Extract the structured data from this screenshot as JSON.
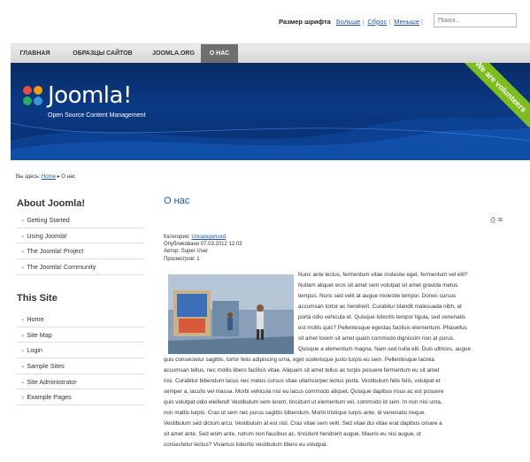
{
  "topbar": {
    "font_size_label": "Размер шрифта",
    "bigger": "Больше",
    "reset": "Сброс",
    "smaller": "Меньше",
    "search_placeholder": "Поиск..."
  },
  "nav": {
    "items": [
      {
        "label": "ГЛАВНАЯ"
      },
      {
        "label": "ОБРАЗЦЫ САЙТОВ"
      },
      {
        "label": "JOOMLA.ORG"
      },
      {
        "label": "О НАС"
      }
    ],
    "active_index": 3
  },
  "header": {
    "logo_text": "Joomla!",
    "tagline": "Open Source Content Management",
    "ribbon": "We are volunteers"
  },
  "breadcrumb": {
    "prefix": "Вы здесь:",
    "home": "Home",
    "arrow": "▸",
    "current": "О нас"
  },
  "sidebar": {
    "about": {
      "title": "About Joomla!",
      "items": [
        "Getting Started",
        "Using Joomla!",
        "The Joomla! Project",
        "The Joomla! Community"
      ]
    },
    "site": {
      "title": "This Site",
      "items": [
        "Home",
        "Site Map",
        "Login",
        "Sample Sites",
        "Site Administrator",
        "Example Pages"
      ]
    }
  },
  "article": {
    "title": "О нас",
    "category_label": "Категория:",
    "category": "Uncategorised",
    "published": "Опубликовано 07.03.2012 12:03",
    "author": "Автор: Super User",
    "hits": "Просмотров: 1",
    "right_lines": [
      "Nunc ante lectus, fermentum vitae molestie eget, fermentum vel elit?",
      "Nullam aliquet eros sit amet sem volutpat sit amet gravida metus",
      "tempus. Nunc sed velit at augue molestie tempor. Donec cursus",
      "accumsan tortor ac hendrerit. Curabitur blandit malesuada nibh, at",
      "porta odio vehicula et. Quisque lobortis tempor ligula, sed venenatis",
      "est mollis quis? Pellentesque egestas facilisis elementum. Phasellus",
      "sit amet lorem sit amet quam commodo dignissim non at purus.",
      "Quisque a elementum magna. Nam sed nulla elit. Duis ultrices, augue"
    ],
    "full_lines": [
      "quis consectetur sagittis, tortor felis adipiscing urna, eget scelerisque justo turpis eu sem. Pellentesque lacinia",
      "accumsan tellus, nec mollis libero facilisis vitae. Aliquam sit amet tellus ac turpis posuere fermentum eu sit amet",
      "nisi. Curabitur bibendum lacus nec metus cursus vitae ullamcorper lectus porta. Vestibulum felis felis, volutpat et",
      "semper a, iaculis vel massa. Morbi vehicula nisi eu lacus commodo aliquet. Quisque dapibus risus ac est posuere",
      "quis volutpat odio eleifend! Vestibulum sem lorem, tincidunt ut elementum vel, commodo id sem. In non nisi urna,",
      "non mattis turpis. Cras ut sem nec purus sagittis bibendum. Morbi tristique turpis ante, id venenatis neque.",
      "Vestibulum sed dictum arcu. Vestibulum at est nisl. Cras vitae sem velit. Sed vitae dui vitae erat dapibus ornare a",
      "sit amet ante. Sed enim ante, rutrum non faucibus ac, tincidunt hendrerit augue. Mauris eu nisi augue, ut",
      "consectetur lectus? Vivamus lobortis vestibulum libero eu volutpat."
    ]
  },
  "colors": {
    "link": "#1b57b1",
    "header_bg": "#0b3a85",
    "ribbon": "#7dbd1f",
    "nav_active": "#6e6e6e"
  }
}
